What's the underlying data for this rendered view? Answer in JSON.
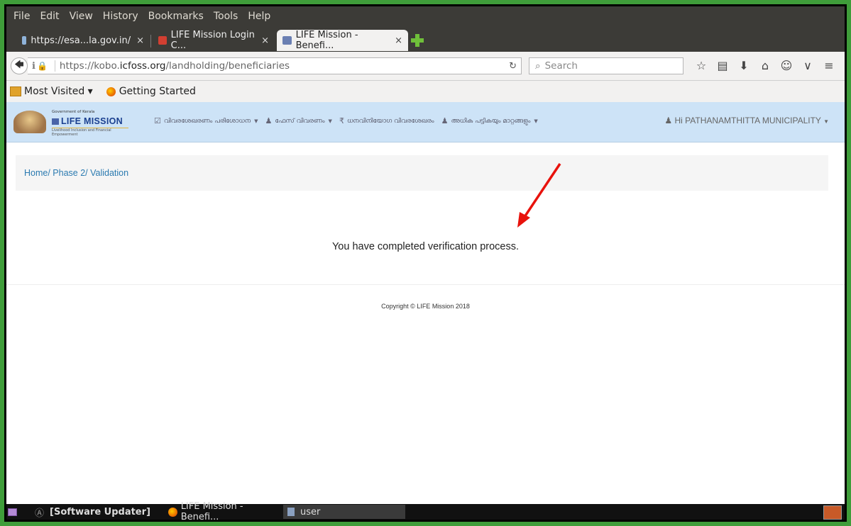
{
  "menubar": {
    "items": [
      "File",
      "Edit",
      "View",
      "History",
      "Bookmarks",
      "Tools",
      "Help"
    ]
  },
  "tabs": [
    {
      "label": "https://esa...la.gov.in/",
      "icon": "page-icon",
      "active": false
    },
    {
      "label": "LIFE Mission Login C...",
      "icon": "gmail-icon",
      "active": false
    },
    {
      "label": "LIFE Mission - Benefi...",
      "icon": "site-icon",
      "active": true
    }
  ],
  "tab_close": "×",
  "navbar": {
    "url_prefix": "https://kobo.",
    "url_domain": "icfoss.org",
    "url_path": "/landholding/beneficiaries",
    "search_placeholder": "Search"
  },
  "bookmarks": [
    {
      "label": "Most Visited ▾",
      "icon": "folder-icon"
    },
    {
      "label": "Getting Started",
      "icon": "firefox-icon"
    }
  ],
  "site": {
    "logo_small": "Government of Kerala",
    "logo_title": "LIFE MISSION",
    "logo_sub": "Livelihood Inclusion and Financial Empowerment",
    "menus": [
      {
        "label": "വിവരശേഖരണം പരിശോധന",
        "icon": "calendar-check-icon"
      },
      {
        "label": "ഫേസ് വിവരണം",
        "icon": "users-icon"
      },
      {
        "label": "ധനവിനിയോഗ വിവരശേഖരം",
        "icon": "rupee-icon"
      },
      {
        "label": "അധിക പട്ടികയും മാറ്റങ്ങളും",
        "icon": "users-icon"
      }
    ],
    "user": "Hi PATHANAMTHITTA MUNICIPALITY"
  },
  "breadcrumb": "Home/ Phase 2/ Validation",
  "message": "You have completed verification process.",
  "copyright": "Copyright © LIFE Mission 2018",
  "taskbar": [
    {
      "label": "[Software Updater]",
      "icon": "updater-icon"
    },
    {
      "label": "LIFE Mission - Benefi...",
      "icon": "firefox-icon"
    },
    {
      "label": "user",
      "icon": "file-manager-icon"
    }
  ],
  "colors": {
    "accent": "#2a7ab0",
    "site_nav": "#cde3f7",
    "annotation_arrow": "#e8120c"
  }
}
